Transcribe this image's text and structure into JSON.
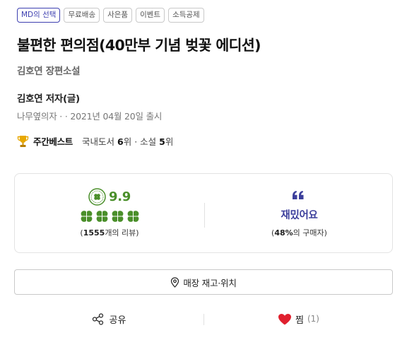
{
  "tags": [
    "MD의 선택",
    "무료배송",
    "사은품",
    "이벤트",
    "소득공제"
  ],
  "title": "불편한 편의점(40만부 기념 벚꽃 에디션)",
  "subtitle": "김호연 장편소설",
  "author": "김호연 저자(글)",
  "publisher": "나무옆의자",
  "publisher_sep": " · · ",
  "pub_date": "2021년 04월 20일 출시",
  "bestseller": {
    "icon": "trophy-icon",
    "label": "주간베스트",
    "rank1_prefix": "국내도서 ",
    "rank1_value": "6",
    "rank1_suffix": "위",
    "rank_sep": " · ",
    "rank2_prefix": "소설 ",
    "rank2_value": "5",
    "rank2_suffix": "위"
  },
  "review": {
    "seal_icon": "klover-seal-icon",
    "score": "9.9",
    "clover_icon": "clover-icon",
    "clovers_filled": 4,
    "count_open": "(",
    "count": "1555",
    "count_suffix": "개의 리뷰)"
  },
  "emotion": {
    "icon": "quote-icon",
    "label": "재밌어요",
    "pct_open": "(",
    "pct": "48%",
    "pct_suffix": "의 구매자)"
  },
  "store_button": {
    "icon": "location-pin-icon",
    "label": "매장 재고·위치"
  },
  "share": {
    "icon": "share-icon",
    "label": "공유"
  },
  "like": {
    "icon": "heart-icon",
    "label": "찜",
    "count": "(1)"
  },
  "colors": {
    "brand": "#3d3fb0",
    "clover_green": "#4a8f2a",
    "heart_red": "#e0202e",
    "trophy_gold": "#e8a800"
  }
}
